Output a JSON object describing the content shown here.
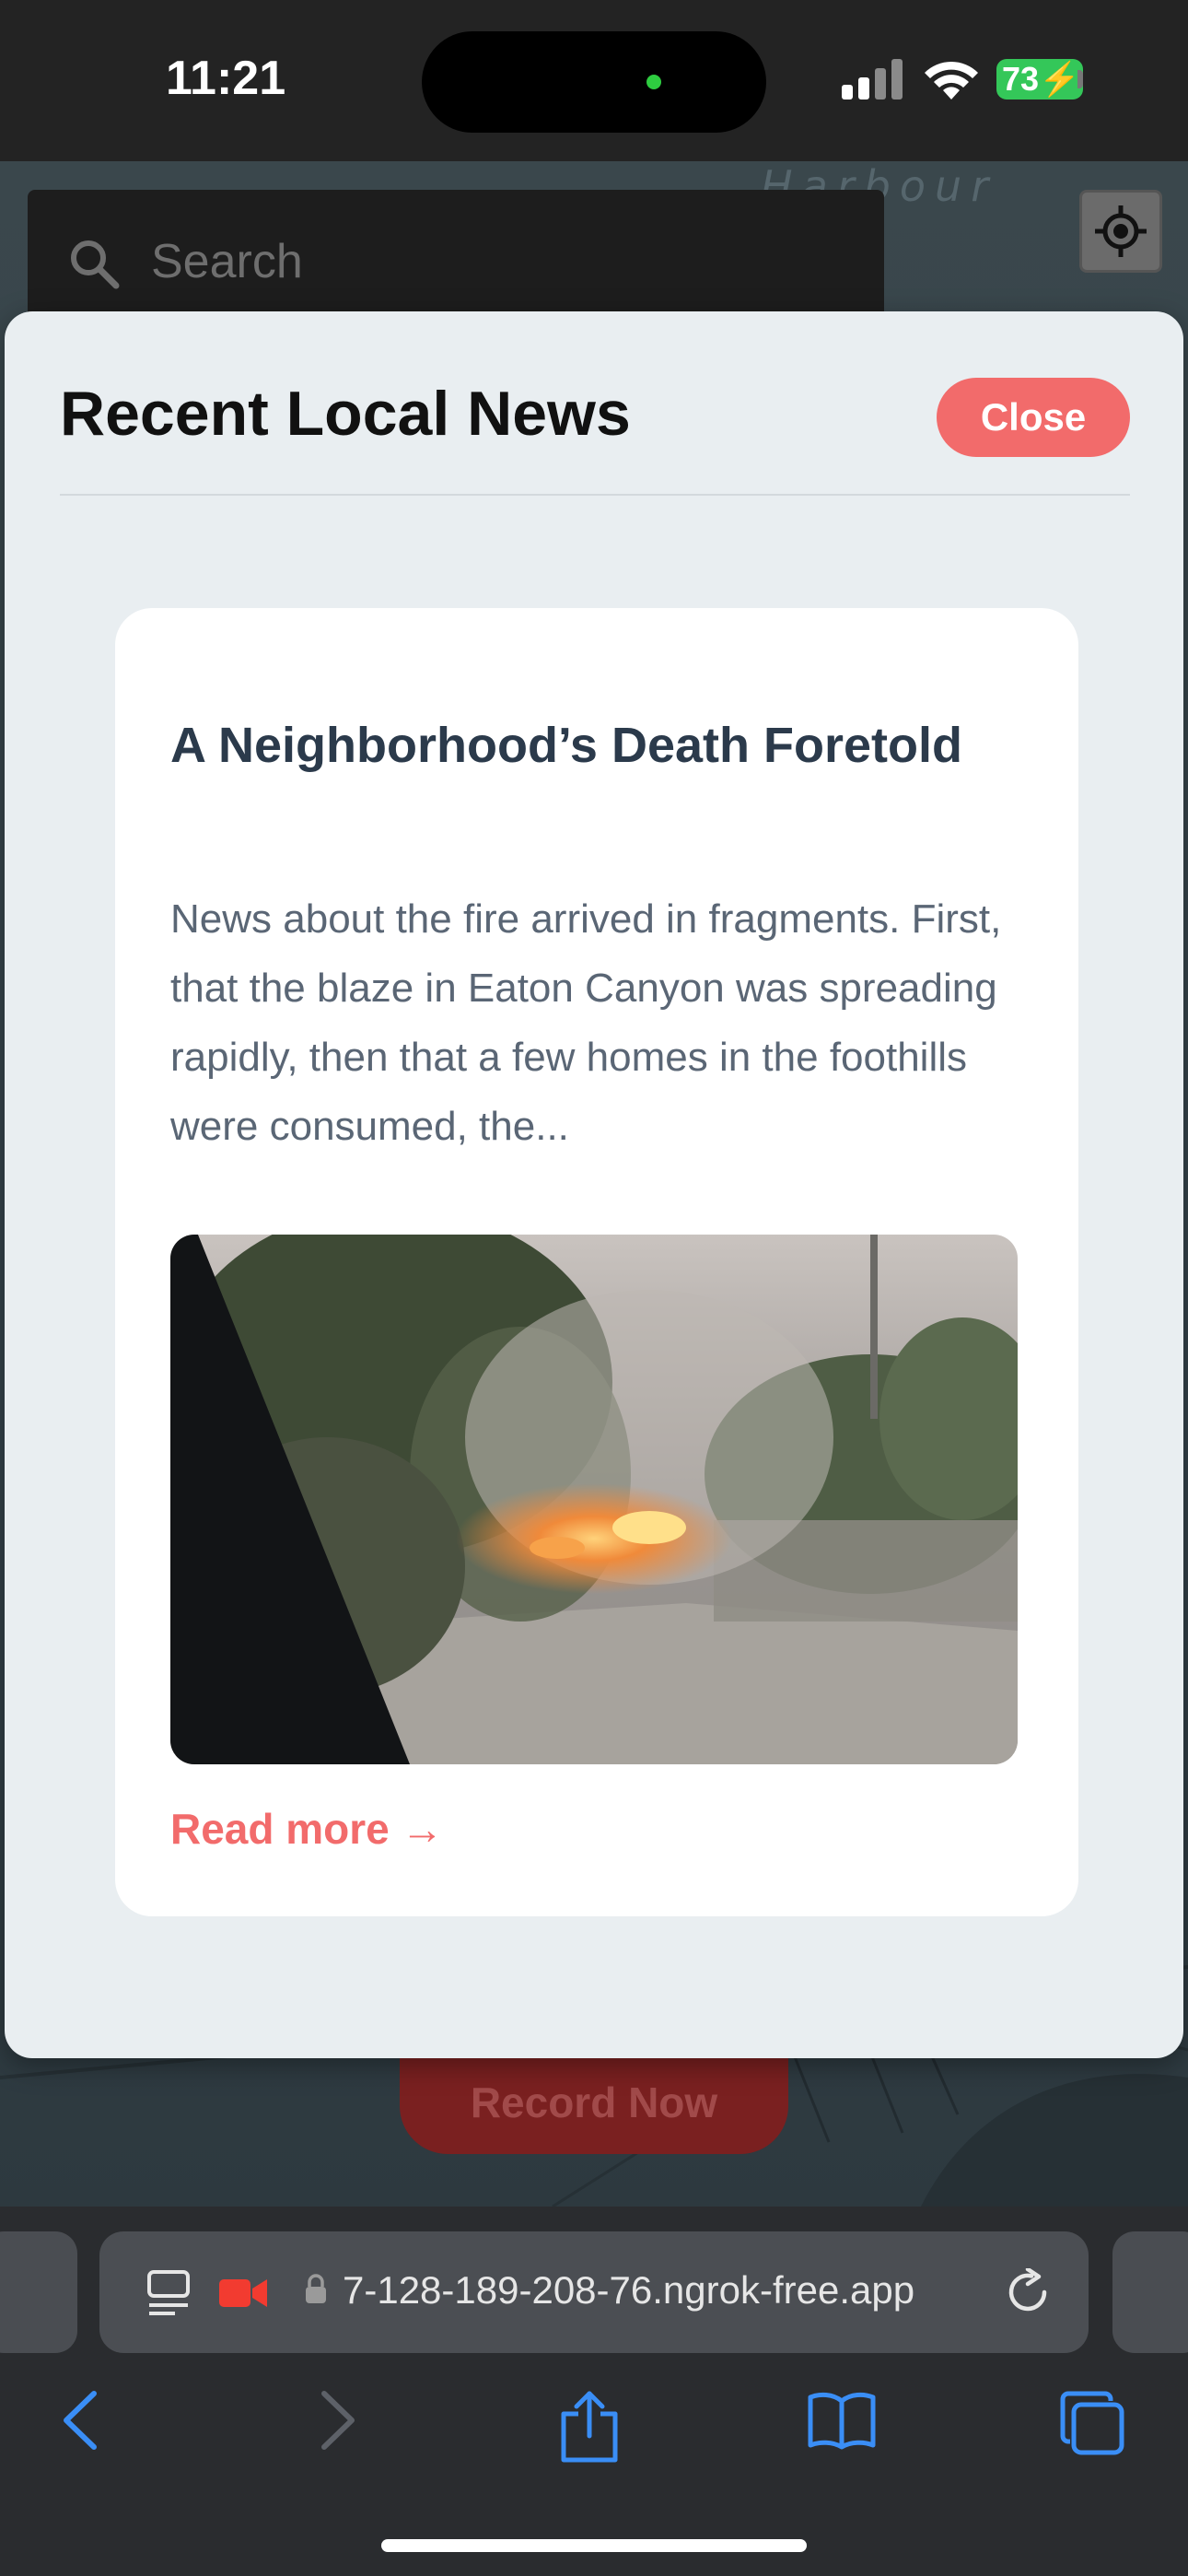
{
  "status_bar": {
    "time": "11:21",
    "battery": "73"
  },
  "map": {
    "label": "Harbour"
  },
  "search": {
    "placeholder": "Search"
  },
  "modal": {
    "title": "Recent Local News",
    "close_label": "Close",
    "article": {
      "headline": "A Neighborhood’s Death Foretold",
      "excerpt": "News about the fire arrived in fragments. First, that the blaze in Eaton Canyon was spreading rapidly, then that a few homes in the foothills were consumed, the...",
      "read_more": "Read more →"
    }
  },
  "record": {
    "label": "Record Now"
  },
  "browser": {
    "url": "7-128-189-208-76.ngrok-free.app"
  },
  "colors": {
    "accent": "#f26b6b",
    "modal_bg": "#e9eef1",
    "headline": "#2b3a4b",
    "excerpt": "#5a6675",
    "battery": "#34c759",
    "browser_blue": "#3a8ef6"
  }
}
